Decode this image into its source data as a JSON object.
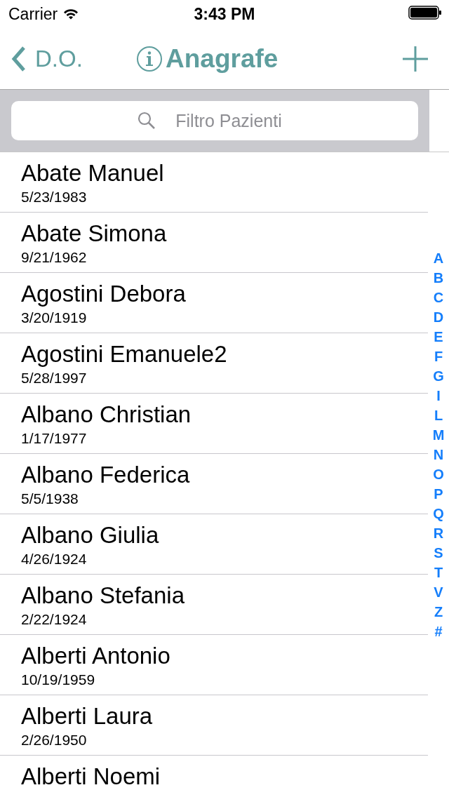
{
  "status_bar": {
    "carrier": "Carrier",
    "time": "3:43 PM"
  },
  "nav": {
    "back": "D.O.",
    "title": "Anagrafe"
  },
  "search": {
    "placeholder": "Filtro Pazienti"
  },
  "patients": [
    {
      "name": "Abate Manuel",
      "date": "5/23/1983"
    },
    {
      "name": "Abate Simona",
      "date": "9/21/1962"
    },
    {
      "name": "Agostini Debora",
      "date": "3/20/1919"
    },
    {
      "name": "Agostini Emanuele2",
      "date": "5/28/1997"
    },
    {
      "name": "Albano Christian",
      "date": "1/17/1977"
    },
    {
      "name": "Albano Federica",
      "date": "5/5/1938"
    },
    {
      "name": "Albano Giulia",
      "date": "4/26/1924"
    },
    {
      "name": "Albano Stefania",
      "date": "2/22/1924"
    },
    {
      "name": "Alberti Antonio",
      "date": "10/19/1959"
    },
    {
      "name": "Alberti Laura",
      "date": "2/26/1950"
    },
    {
      "name": "Alberti Noemi"
    }
  ],
  "index": [
    "A",
    "B",
    "C",
    "D",
    "E",
    "F",
    "G",
    "I",
    "L",
    "M",
    "N",
    "O",
    "P",
    "Q",
    "R",
    "S",
    "T",
    "V",
    "Z",
    "#"
  ]
}
